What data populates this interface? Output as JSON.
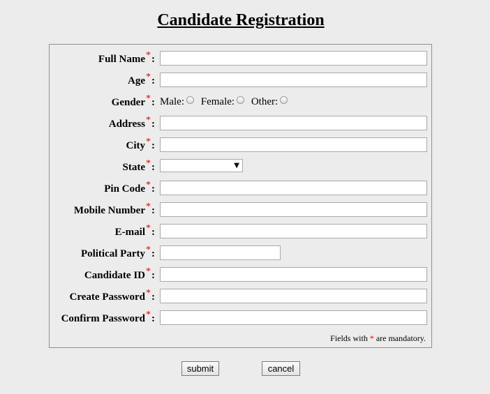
{
  "page": {
    "title": "Candidate Registration"
  },
  "form": {
    "required_marker": "*",
    "colon": ":",
    "fields": {
      "full_name": {
        "label": "Full Name",
        "value": ""
      },
      "age": {
        "label": "Age",
        "value": ""
      },
      "gender": {
        "label": "Gender",
        "options": [
          "Male:",
          "Female:",
          "Other:"
        ]
      },
      "address": {
        "label": "Address",
        "value": ""
      },
      "city": {
        "label": "City",
        "value": ""
      },
      "state": {
        "label": "State",
        "value": ""
      },
      "pin_code": {
        "label": "Pin Code",
        "value": ""
      },
      "mobile_number": {
        "label": "Mobile Number",
        "value": ""
      },
      "email": {
        "label": "E-mail",
        "value": ""
      },
      "political_party": {
        "label": "Political Party",
        "value": ""
      },
      "candidate_id": {
        "label": "Candidate ID",
        "value": ""
      },
      "create_password": {
        "label": "Create Password",
        "value": ""
      },
      "confirm_password": {
        "label": "Confirm Password",
        "value": ""
      }
    },
    "note": {
      "before": "Fields with",
      "marker": "*",
      "after": "are mandatory."
    }
  },
  "buttons": {
    "submit": "submit",
    "cancel": "cancel"
  },
  "colors": {
    "background": "#ececec",
    "required": "#e00000",
    "border": "#8f8f8f"
  }
}
